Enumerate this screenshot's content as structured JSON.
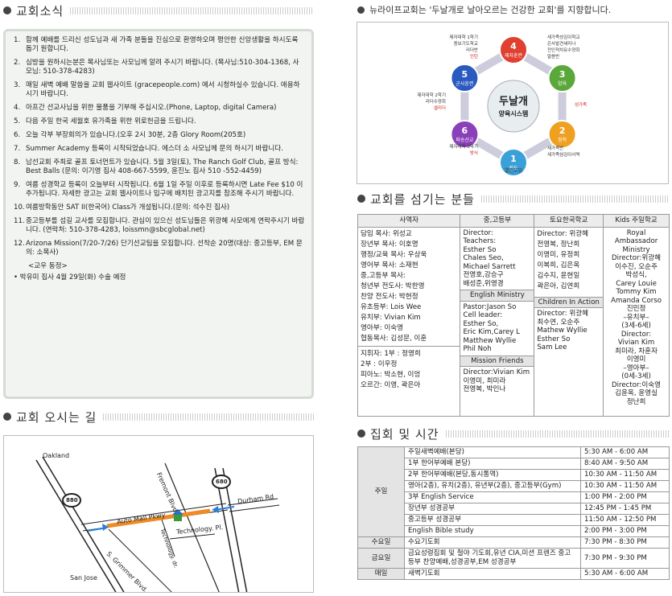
{
  "sections": {
    "news_title": "교회소식",
    "directions_title": "교회 오시는 길",
    "vision_line": "뉴라이프교회는 '두날개로 날아오르는 건강한 교회'를 지향합니다.",
    "staff_title": "교회를 섬기는 분들",
    "schedule_title": "집회 및 시간"
  },
  "news": {
    "items": [
      {
        "num": "1.",
        "text": "함께 예배를 드리신 성도님과 새 가족 분들을 진심으로 환영하오며 평안한 신앙생활을 하시도록 돕기 원합니다."
      },
      {
        "num": "2.",
        "text": "심방을 원하시는분은 목사님또는 사모님께 알려 주시기 바랍니다. (목사님:510-304-1368, 사모님: 510-378-4283)"
      },
      {
        "num": "3.",
        "text": "매일 새벽 예배 말씀을 교회 웹사이트 (gracepeople.com) 에서 시청하실수 있습니다. 애용하시기 바랍니다."
      },
      {
        "num": "4.",
        "text": "아프간 선교사님을 위한 물품을 기부해 주십시오.(Phone, Laptop, digital Camera)"
      },
      {
        "num": "5.",
        "text": "다음 주일 한국 세월호 유가족을 위한 위로헌금을 드립니다."
      },
      {
        "num": "6.",
        "text": "오늘 각부 부장회의가 있습니다.(오후 2시 30분, 2층 Glory Room(205호)"
      },
      {
        "num": "7.",
        "text": "Summer Academy 등록이 시작되었습니다. 에스더 소 사모님께 문의 하시기 바랍니다."
      },
      {
        "num": "8.",
        "text": "남선교회 주최로 골프 토너먼트가 있습니다. 5월 3일(토), The Ranch Golf Club, 골프 방식: Best Balls (문의: 이기영 집사 408-667-5599, 윤진노 집사 510 -552-4459)"
      },
      {
        "num": "9.",
        "text": "여름 성경학교 등록이 오늘부터 시작됩니다. 6월 1일 주일 이후로 등록하시면 Late Fee $10 이 추가됩니다. 자세한 광고는 교회 웹사이트나 입구에 배치된 광고지를 참조해 주시기 바랍니다."
      },
      {
        "num": "10.",
        "text": "여름방학동안 SAT II(한국어) Class가 개설됩니다.(문의: 석수진 집사)"
      },
      {
        "num": "11.",
        "text": "중고등부를 섬길 교사를 모집합니다. 관심이 있으신 성도님들은 위광혜 사모에게 연락주시기 바랍니다. (연락처: 510-378-4283, loissmn@sbcglobal.net)"
      },
      {
        "num": "12.",
        "text": "Arizona Mission(7/20-7/26) 단기선교팀을 모집합니다. 선착순 20명(대상: 중고등부, EM 문의: 소목사)"
      }
    ],
    "prayer_title": "<교우 동정>",
    "prayer_item": "• 박유미 집사 4월 29일(화) 수술 예정"
  },
  "map": {
    "oakland": "Oakland",
    "san_jose": "San Jose",
    "fremont": "Fremont Blvd.",
    "auto_mall": "Auto Mall Pkwy",
    "durham": "Durham Rd",
    "technology_dr": "Technology. dr.",
    "technology_pl": "Technology. Pl.",
    "grimmer": "S. Grimmer Blvd.",
    "hw_880": "880",
    "hw_680": "680"
  },
  "diagram": {
    "center_title": "두날개",
    "center_sub": "양육시스템",
    "nodes": [
      {
        "n": "1",
        "name": "전도"
      },
      {
        "n": "2",
        "name": "정착"
      },
      {
        "n": "3",
        "name": "양육"
      },
      {
        "n": "4",
        "name": "제자훈련"
      },
      {
        "n": "5",
        "name": "군사훈련"
      },
      {
        "n": "6",
        "name": "파송선교"
      }
    ],
    "notes": {
      "top_left": [
        "제자대학 1학기",
        "종보기도학교",
        "리더반"
      ],
      "top_left_red": "인턴",
      "top_right": [
        "새가족성김이학교",
        "은사발견세미나",
        "전인적치유수양회",
        "말씀반"
      ],
      "left": [
        "제자대학 2학기",
        "리더수양회"
      ],
      "left_red": "셀리더",
      "right_red": "성가족",
      "bottom_left": [
        "제자대학 3학기"
      ],
      "bottom_left_red": "방식",
      "bottom_right": [
        "새가족반",
        "새가족섬김이사역"
      ],
      "bottom": "열린모임"
    }
  },
  "staff": {
    "headers": [
      "사역자",
      "중,고등부",
      "토요한국학교",
      "Kids 주일학교"
    ],
    "col1": [
      "담임 목사: 위성교",
      "장년부 목사: 이호명",
      "행정/교육 목사: 우상욱",
      "영어부 목사: 소재현",
      "중,고등부 목사:",
      "청년부 전도사: 박한영",
      "찬양 전도사: 박현정",
      "유초등부: Lois Wee",
      "유치부: Vivian Kim",
      "영아부: 이숙영",
      "협동목사: 김성문, 이훈"
    ],
    "col1_b": [
      "지휘자: 1부 : 정영희",
      "2부 : 이우정",
      "피아노: 박소현, 이엉",
      "오르간: 이영, 곽은아"
    ],
    "col2": [
      "Director:",
      "Teachers:",
      "Esther So",
      "Chales Seo,",
      "Michael Sarrett",
      "전영호,강승구",
      "배성준,위영경"
    ],
    "col2_em_head": "English Ministry",
    "col2_em": [
      "Pastor:Jason So",
      "Cell leader:",
      "Esther So,",
      "Eric Kim,Carey L",
      "Matthew Wyllie",
      "Phil Noh"
    ],
    "col2_mf_head": "Mission Friends",
    "col2_mf": [
      "Director:Vivian Kim",
      "이영미, 최미라",
      "전영복, 박인나"
    ],
    "col3": [
      "Director: 위광혜",
      "전영복, 정난희",
      "이영미, 유정희",
      "이복희, 김은옥",
      "김수지, 윤현일",
      "곽은아, 김연희"
    ],
    "col3_ca_head": "Children In Action",
    "col3_ca": [
      "Director: 위광혜",
      "최수연, 오순주",
      "Mathew Wyllie",
      "Esther So",
      "Sam Lee"
    ],
    "col4": [
      "Royal Ambassador",
      "Ministry",
      "Director:위광혜",
      "이수진, 오순주",
      "박성식,",
      "Carey Louie",
      "Tommy Kim",
      "Amanda Corso",
      "진민정",
      "–유치부–",
      "(3세-6세)",
      "Director:",
      "Vivian Kim",
      "최미라, 차훈자",
      "이영미",
      "–영아부–",
      "(0세-3세)",
      "Director:이숙영",
      "김윤옥, 윤영실",
      "정난희"
    ]
  },
  "schedule": {
    "groups": [
      {
        "label": "주일",
        "rows": [
          [
            "주일새벽예배(본당)",
            "5:30 AM - 6:00 AM"
          ],
          [
            "1부 한어부예배 본당)",
            "8:40 AM - 9:50 AM"
          ],
          [
            "2부 한어부예배(본당,동시통역)",
            "10:30 AM - 11:50 AM"
          ],
          [
            "영아(2층), 유치(2층), 유년부(2층), 중고등부(Gym)",
            "10:30 AM - 11:50 AM"
          ],
          [
            "3부 English Service",
            "1:00 PM - 2:00 PM"
          ],
          [
            "장년부 성경공부",
            "12:45 PM - 1:45 PM"
          ],
          [
            "중고등부 성경공부",
            "11:50 AM - 12:50 PM"
          ],
          [
            "English Bible study",
            "2:00 PM - 3:00 PM"
          ]
        ]
      },
      {
        "label": "수요일",
        "rows": [
          [
            "수요기도회",
            "7:30 PM - 8:30 PM"
          ]
        ]
      },
      {
        "label": "금요일",
        "rows": [
          [
            "금요성령집회 및 철야 기도회,유년 CIA,미션 프렌즈 중고등부 찬양예배,성경공부,EM 성경공부",
            "7:30 PM - 9:30 PM"
          ]
        ]
      },
      {
        "label": "매일",
        "rows": [
          [
            "새벽기도회",
            "5:30 AM - 6:00 AM"
          ]
        ]
      }
    ]
  }
}
